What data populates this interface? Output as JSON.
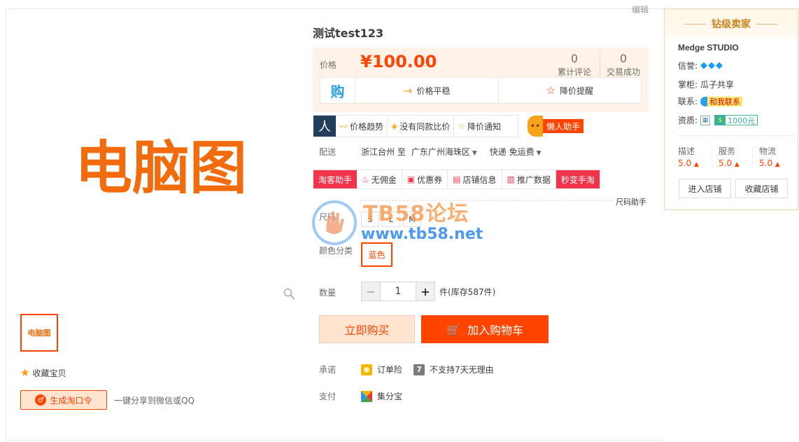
{
  "page": {
    "edit_label": "编辑"
  },
  "gallery": {
    "main_image_text": "电脑图",
    "thumb_text": "电脑图",
    "favorite_label": "收藏宝贝",
    "generate_label": "生成淘口令",
    "share_text": "一键分享到微信或QQ"
  },
  "item": {
    "title": "测试test123",
    "price_label": "价格",
    "price": "¥100.00",
    "reviews_count": "0",
    "reviews_label": "累计评论",
    "deals_count": "0",
    "deals_label": "交易成功",
    "buy_glyph": "购",
    "price_trend_label": "价格平稳",
    "price_alert_label": "降价提醒"
  },
  "helper": {
    "logo_glyph": "人",
    "items": [
      "价格趋势",
      "没有同款比价",
      "降价通知"
    ],
    "lazy_label": "懒人助手"
  },
  "delivery": {
    "label": "配送",
    "from": "浙江台州 至",
    "to": "广东广州海珠区",
    "method": "快递 免运费"
  },
  "taoke": {
    "items": [
      "淘客助手",
      "无佣金",
      "优惠券",
      "店铺信息",
      "推广数据",
      "秒变手淘"
    ],
    "size_helper": "尺码助手"
  },
  "sku": {
    "size_label": "尺码",
    "sizes": [
      "S",
      "L",
      "M"
    ],
    "color_label": "颜色分类",
    "color_selected": "蓝色"
  },
  "watermark": {
    "title": "TB58论坛",
    "url": "www.tb58.net"
  },
  "quantity": {
    "label": "数量",
    "value": "1",
    "minus": "−",
    "plus": "+",
    "stock": "件(库存587件)"
  },
  "actions": {
    "buy_now": "立即购买",
    "add_cart": "加入购物车"
  },
  "promise": {
    "label": "承诺",
    "item1": "订单险",
    "item2": "不支持7天无理由",
    "grey_badge": "7"
  },
  "payment": {
    "label": "支付",
    "item1": "集分宝"
  },
  "seller": {
    "level": "钻级卖家",
    "shop_name": "Medge STUDIO",
    "credit_label": "信誉:",
    "credit_diamonds": 3,
    "owner_label": "掌柜:",
    "owner": "瓜子共享",
    "contact_label": "联系:",
    "contact_text": "和我联系",
    "qualify_label": "资质:",
    "bond": "1000元",
    "scores": [
      {
        "label": "描述",
        "value": "5.0"
      },
      {
        "label": "服务",
        "value": "5.0"
      },
      {
        "label": "物流",
        "value": "5.0"
      }
    ],
    "enter_shop": "进入店铺",
    "fav_shop": "收藏店铺"
  },
  "colors": {
    "accent": "#ff4400",
    "price_bg": "#fff2e8",
    "helper_red": "#f1334b"
  }
}
